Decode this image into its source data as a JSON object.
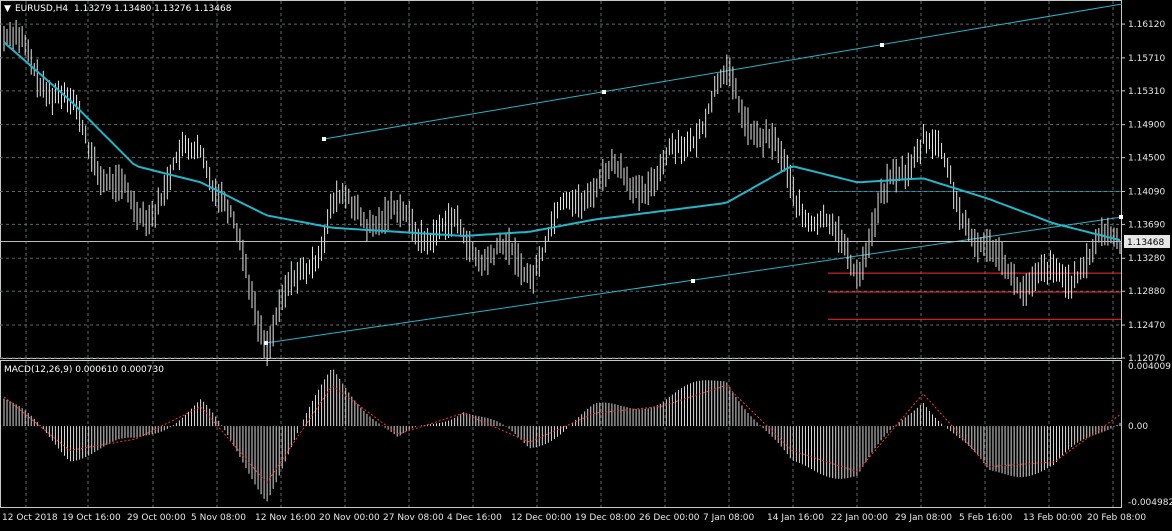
{
  "header": {
    "symbol_tf": "EURUSD,H4",
    "ohlc": "1.13279 1.13480 1.13276 1.13468"
  },
  "price_panel": {
    "current_price_label": "1.13468",
    "y_ticks": [
      "1.16120",
      "1.15710",
      "1.15310",
      "1.14900",
      "1.14500",
      "1.14090",
      "1.13690",
      "1.13280",
      "1.12880",
      "1.12470",
      "1.12070"
    ]
  },
  "macd_panel": {
    "label": "MACD(12,26,9) 0.000610 0.000730",
    "y_ticks": [
      "0.004009",
      "0.00",
      "-0.004982"
    ]
  },
  "x_axis": {
    "labels": [
      "12 Oct 2018",
      "19 Oct 16:00",
      "29 Oct 00:00",
      "5 Nov 08:00",
      "12 Nov 16:00",
      "20 Nov 00:00",
      "27 Nov 08:00",
      "4 Dec 16:00",
      "12 Dec 00:00",
      "19 Dec 08:00",
      "26 Dec 00:00",
      "7 Jan 08:00",
      "14 Jan 16:00",
      "22 Jan 00:00",
      "29 Jan 08:00",
      "5 Feb 16:00",
      "13 Feb 00:00",
      "20 Feb 08:00"
    ]
  },
  "colors": {
    "background": "#000000",
    "bars": "#e6e6e6",
    "moving_average": "#21b6c9",
    "channel": "#21b6c9",
    "horizontal_levels": "#ff2b2b",
    "macd_hist": "#d8d8d8",
    "macd_signal": "#ff3030",
    "price_label_bg": "#e6e6e6"
  },
  "chart_data": [
    {
      "type": "line",
      "title": "EURUSD,H4",
      "x": [
        "12 Oct 2018",
        "19 Oct 16:00",
        "29 Oct 00:00",
        "5 Nov 08:00",
        "12 Nov 16:00",
        "20 Nov 00:00",
        "27 Nov 08:00",
        "4 Dec 16:00",
        "12 Dec 00:00",
        "19 Dec 08:00",
        "26 Dec 00:00",
        "7 Jan 08:00",
        "14 Jan 16:00",
        "22 Jan 00:00",
        "29 Jan 08:00",
        "5 Feb 16:00",
        "13 Feb 00:00",
        "20 Feb 08:00"
      ],
      "series": [
        {
          "values": [
            1.1595,
            1.15,
            1.139,
            1.146,
            1.1235,
            1.1395,
            1.136,
            1.1365,
            1.1315,
            1.142,
            1.144,
            1.153,
            1.142,
            1.133,
            1.147,
            1.134,
            1.129,
            1.1346
          ]
        },
        {
          "values": [
            1.159,
            1.152,
            1.144,
            1.142,
            1.138,
            1.1365,
            1.136,
            1.1355,
            1.136,
            1.1375,
            1.1385,
            1.1395,
            1.144,
            1.142,
            1.1425,
            1.14,
            1.137,
            1.135
          ]
        }
      ],
      "ylim": [
        1.1207,
        1.164
      ],
      "grid": true
    },
    {
      "type": "bar",
      "title": "MACD(12,26,9) 0.000610 0.000730",
      "x": [
        "12 Oct 2018",
        "19 Oct 16:00",
        "29 Oct 00:00",
        "5 Nov 08:00",
        "12 Nov 16:00",
        "20 Nov 00:00",
        "27 Nov 08:00",
        "4 Dec 16:00",
        "12 Dec 00:00",
        "19 Dec 08:00",
        "26 Dec 00:00",
        "7 Jan 08:00",
        "14 Jan 16:00",
        "22 Jan 00:00",
        "29 Jan 08:00",
        "5 Feb 16:00",
        "13 Feb 00:00",
        "20 Feb 08:00"
      ],
      "series": [
        {
          "values": [
            0.0017,
            -0.0018,
            -0.001,
            0.0015,
            -0.0043,
            0.0035,
            -0.001,
            0.0012,
            -0.0013,
            0.001,
            0.0016,
            0.003,
            -0.0025,
            -0.003,
            0.0018,
            -0.003,
            -0.0025,
            0.0006
          ]
        },
        {
          "values": [
            0.0018,
            -0.0015,
            -0.0008,
            0.0012,
            -0.0035,
            0.0025,
            -0.0005,
            0.0008,
            -0.001,
            0.0008,
            0.0012,
            0.0025,
            -0.0015,
            -0.0028,
            0.002,
            -0.0025,
            -0.0022,
            0.0007
          ]
        }
      ],
      "ylim": [
        -0.004982,
        0.004009
      ],
      "grid": true
    }
  ]
}
